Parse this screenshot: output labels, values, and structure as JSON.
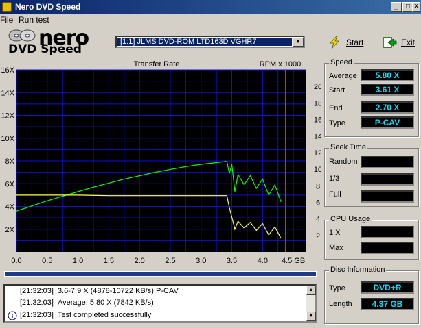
{
  "window": {
    "title": "Nero DVD Speed"
  },
  "menu": {
    "file": "File",
    "run_test": "Run test"
  },
  "logo": {
    "line1": "nero",
    "line2": "DVD Speed"
  },
  "drive": {
    "selected": "[1:1]  JLMS DVD-ROM LTD163D VGHR7"
  },
  "buttons": {
    "start": "Start",
    "exit": "Exit"
  },
  "graph": {
    "title": "Transfer Rate",
    "right_title": "RPM x 1000",
    "y_left_ticks": [
      "16X",
      "14X",
      "12X",
      "10X",
      "8X",
      "6X",
      "4X",
      "2X"
    ],
    "y_right_ticks": [
      "20",
      "18",
      "16",
      "14",
      "12",
      "10",
      "8",
      "6",
      "4",
      "2"
    ],
    "x_ticks": [
      "0.0",
      "0.5",
      "1.0",
      "1.5",
      "2.0",
      "2.5",
      "3.0",
      "3.5",
      "4.0",
      "4.5 GB"
    ],
    "colors": {
      "background": "#000000",
      "grid": "#1010d0",
      "transfer": "#00ff00",
      "rpm": "#ffff40",
      "marker": "#ff2020"
    }
  },
  "chart_data": {
    "type": "line",
    "title": "Transfer Rate",
    "xlabel": "GB",
    "ylabel": "",
    "y2label": "RPM x 1000",
    "xlim": [
      0,
      4.7
    ],
    "ylim": [
      0,
      16
    ],
    "y2lim": [
      0,
      22
    ],
    "grid": true,
    "series": [
      {
        "name": "",
        "x": [
          0.0,
          0.25,
          0.5,
          0.75,
          1.0,
          1.25,
          1.5,
          1.75,
          2.0,
          2.25,
          2.5,
          2.75,
          3.0,
          3.25,
          3.42,
          3.46,
          3.5,
          3.55,
          3.6,
          3.7,
          3.8,
          3.9,
          4.0,
          4.1,
          4.2,
          4.3
        ],
        "values": [
          3.6,
          4.05,
          4.5,
          4.9,
          5.3,
          5.7,
          6.05,
          6.4,
          6.7,
          7.0,
          7.25,
          7.5,
          7.7,
          7.85,
          7.95,
          6.9,
          7.7,
          5.3,
          6.8,
          5.9,
          6.7,
          5.6,
          6.4,
          5.0,
          5.9,
          4.4
        ]
      },
      {
        "name": "",
        "x": [
          0.0,
          0.5,
          1.0,
          1.5,
          2.0,
          2.5,
          3.0,
          3.42,
          3.46,
          3.55,
          3.6,
          3.7,
          3.8,
          3.9,
          4.0,
          4.1,
          4.2,
          4.3
        ],
        "values": [
          5.0,
          5.0,
          5.0,
          4.95,
          4.95,
          4.95,
          4.95,
          4.95,
          3.9,
          2.0,
          2.7,
          2.1,
          2.6,
          1.9,
          2.5,
          1.5,
          2.2,
          1.2
        ]
      }
    ]
  },
  "speed": {
    "title": "Speed",
    "average_label": "Average",
    "average": "5.80 X",
    "start_label": "Start",
    "start": "3.61 X",
    "end_label": "End",
    "end": "2.70 X",
    "type_label": "Type",
    "type": "P-CAV"
  },
  "seek": {
    "title": "Seek Time",
    "random_label": "Random",
    "third_label": "1/3",
    "full_label": "Full"
  },
  "cpu": {
    "title": "CPU Usage",
    "x1_label": "1 X",
    "max_label": "Max"
  },
  "disc": {
    "title": "Disc Information",
    "type_label": "Type",
    "type": "DVD+R",
    "length_label": "Length",
    "length": "4.37 GB"
  },
  "log": [
    {
      "time": "[21:32:03]",
      "text": "3.6-7.9 X (4878-10722 KB/s) P-CAV"
    },
    {
      "time": "[21:32:03]",
      "text": "Average: 5.80 X (7842 KB/s)"
    },
    {
      "time": "[21:32:03]",
      "text": "Test completed successfully"
    }
  ]
}
